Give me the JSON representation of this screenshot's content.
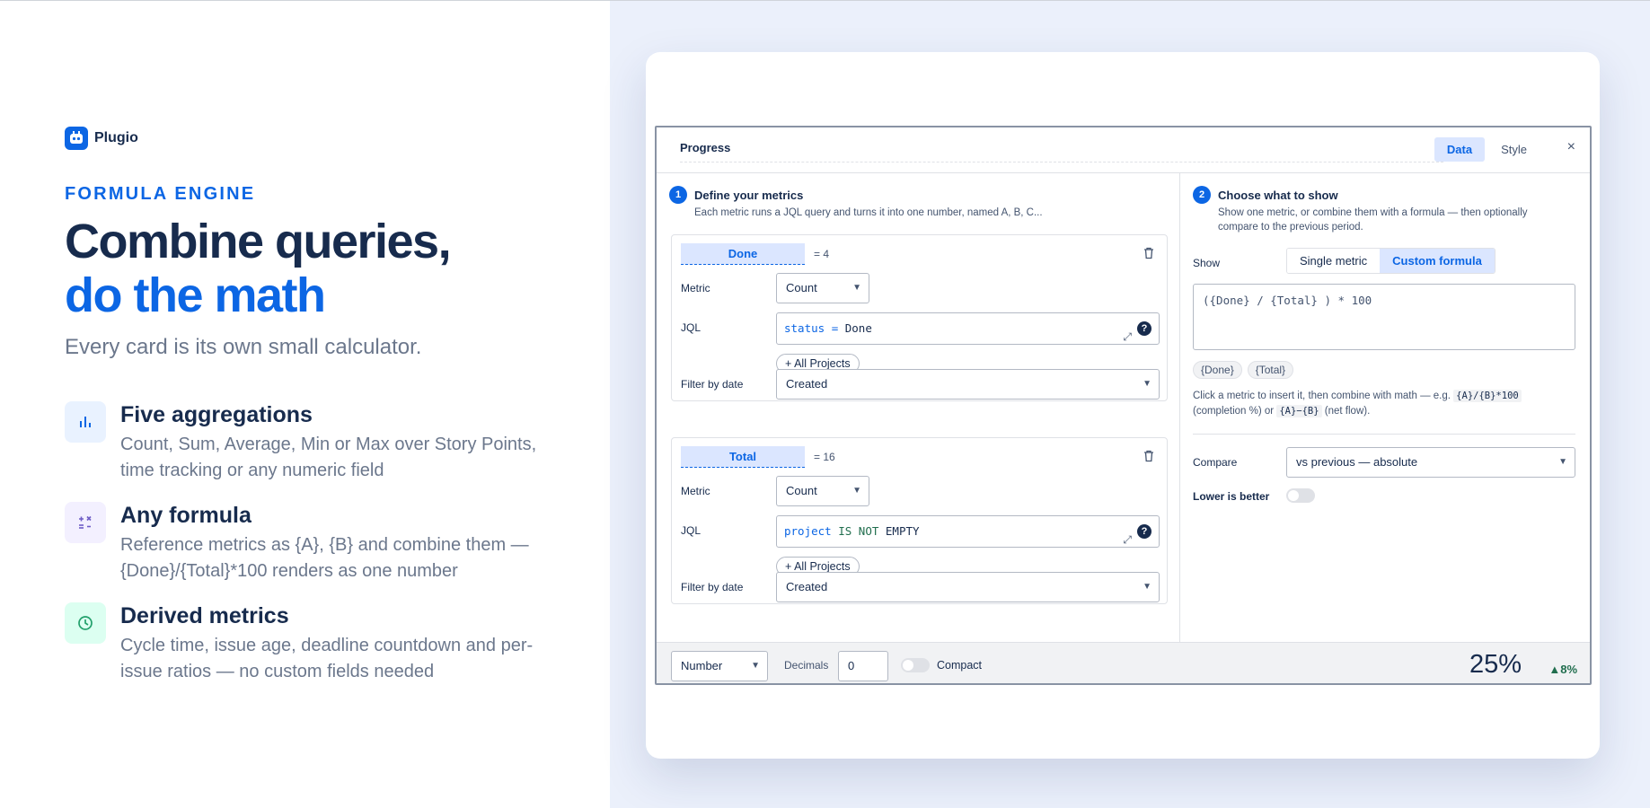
{
  "brand": {
    "name": "Plugio"
  },
  "hero": {
    "eyebrow": "FORMULA ENGINE",
    "title_line1": "Combine queries,",
    "title_line2": "do the math",
    "tagline": "Every card is its own small calculator."
  },
  "features": [
    {
      "title": "Five aggregations",
      "desc": "Count, Sum, Average, Min or Max over Story Points, time tracking or any numeric field",
      "icon": "bar-chart-icon",
      "bg": "#e9f2ff",
      "fg": "#0c66e4"
    },
    {
      "title": "Any formula",
      "desc": "Reference metrics as {A}, {B} and combine them — {Done}/{Total}*100 renders as one number",
      "icon": "math-operators-icon",
      "bg": "#f3f0ff",
      "fg": "#6e5dc6"
    },
    {
      "title": "Derived metrics",
      "desc": "Cycle time, issue age, deadline countdown and per-issue ratios — no custom fields needed",
      "icon": "clock-icon",
      "bg": "#dcfff1",
      "fg": "#22a06b"
    }
  ],
  "panel": {
    "title": "Progress",
    "tabs": [
      "Data",
      "Style"
    ],
    "close": "×",
    "step1": {
      "num": "1",
      "title": "Define your metrics",
      "subtitle": "Each metric runs a JQL query and turns it into one number, named A, B, C..."
    },
    "metrics": [
      {
        "name": "Done",
        "value": "= 4",
        "metric_label": "Metric",
        "metric": "Count",
        "jql_label": "JQL",
        "jql_kw": "status",
        "jql_op": "=",
        "jql_rest": "Done",
        "projects": "+ All Projects",
        "date_label": "Filter by date",
        "date": "Created"
      },
      {
        "name": "Total",
        "value": "= 16",
        "metric_label": "Metric",
        "metric": "Count",
        "jql_label": "JQL",
        "jql_kw": "project",
        "jql_op": "IS NOT",
        "jql_rest": "EMPTY",
        "projects": "+ All Projects",
        "date_label": "Filter by date",
        "date": "Created"
      }
    ],
    "step2": {
      "num": "2",
      "title": "Choose what to show",
      "subtitle_line1": "Show one metric, or combine them with a formula — then optionally",
      "subtitle_line2": "compare to the previous period."
    },
    "show_label": "Show",
    "show_options": [
      "Single metric",
      "Custom formula"
    ],
    "formula": "({Done} / {Total} ) * 100",
    "chips": [
      "{Done}",
      "{Total}"
    ],
    "hint": {
      "pre": "Click a metric to insert it, then combine with math — e.g.",
      "code1": "{A}/{B}*100",
      "mid": "(completion %) or",
      "code2": "{A}−{B}",
      "post": "(net flow)."
    },
    "compare_label": "Compare",
    "compare_value": "vs previous — absolute",
    "lower_label": "Lower is better",
    "footer": {
      "format": "Number",
      "decimals_label": "Decimals",
      "decimals": "0",
      "compact_label": "Compact",
      "result": "25%",
      "delta": "▲8%"
    }
  }
}
